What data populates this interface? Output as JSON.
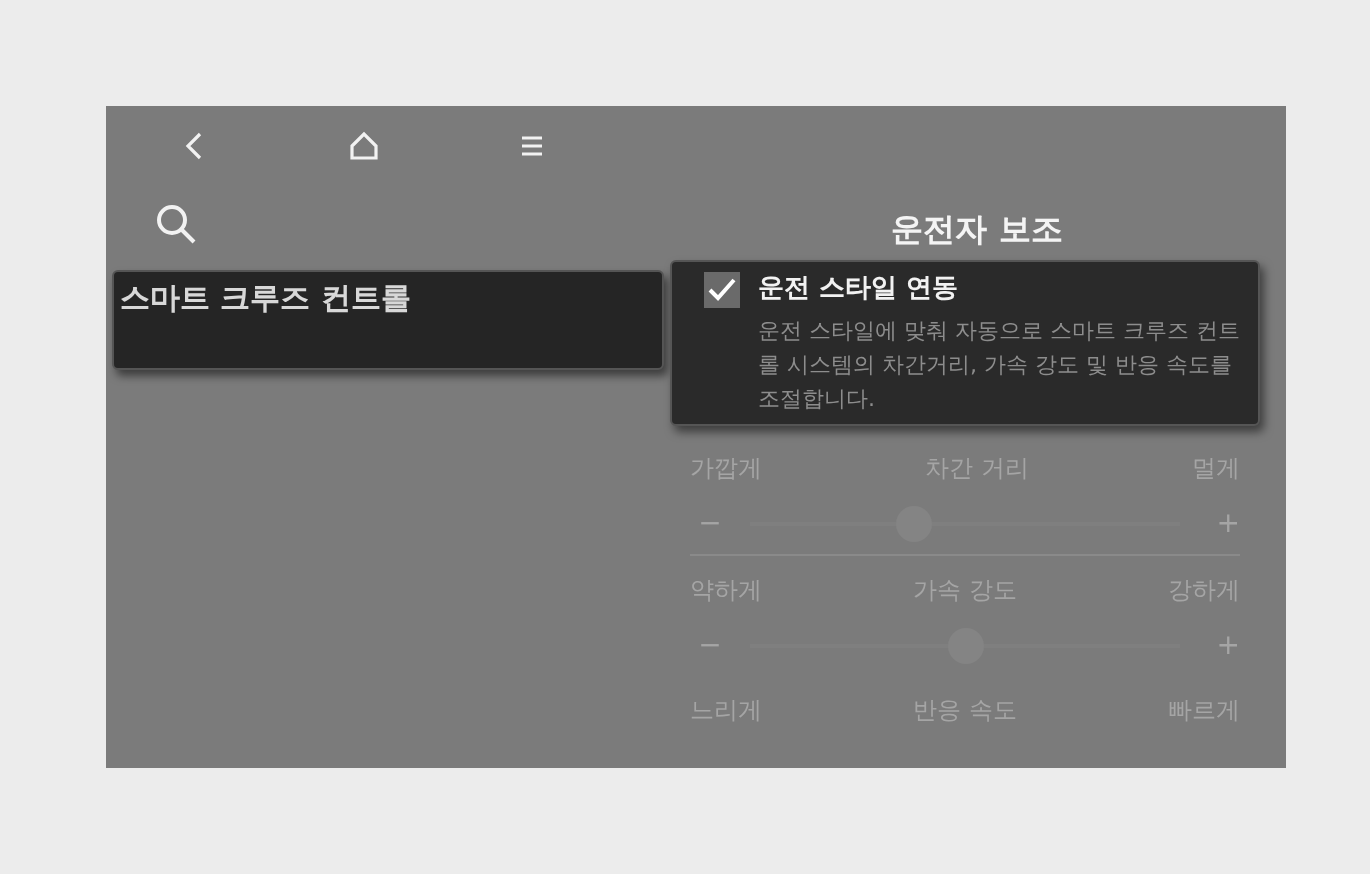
{
  "nav": {
    "items": [
      {
        "kind": "back"
      },
      {
        "kind": "home"
      },
      {
        "kind": "menu"
      }
    ]
  },
  "sidebar": {
    "items": [
      {
        "label": "스마트 크루즈 컨트롤",
        "selected": true
      }
    ]
  },
  "panel": {
    "title": "운전자 보조",
    "option": {
      "label": "운전 스타일 연동",
      "checked": true,
      "description": "운전 스타일에 맞춰 자동으로 스마트 크루즈 컨트롤 시스템의 차간거리, 가속 강도 및 반응 속도를 조절합니다."
    },
    "sliders": [
      {
        "low": "가깝게",
        "label": "차간 거리",
        "high": "멀게",
        "minus": "−",
        "plus": "+",
        "level": 0.38,
        "disabled": true
      },
      {
        "low": "약하게",
        "label": "가속 강도",
        "high": "강하게",
        "minus": "−",
        "plus": "+",
        "level": 0.5,
        "disabled": true
      },
      {
        "low": "느리게",
        "label": "반응 속도",
        "high": "빠르게",
        "disabled": true
      }
    ]
  }
}
